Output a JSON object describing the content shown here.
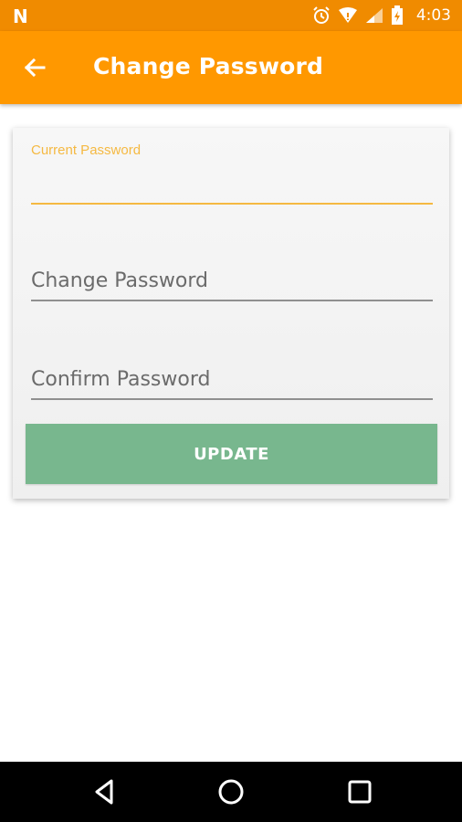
{
  "status_bar": {
    "time": "4:03",
    "notification_icon": "n-logo-icon",
    "icons": [
      "alarm-icon",
      "wifi-icon",
      "cell-signal-icon",
      "battery-icon"
    ],
    "background": "#f08b00"
  },
  "app_bar": {
    "title": "Change Password",
    "back_icon": "back-arrow-icon",
    "background": "#ff9800"
  },
  "form": {
    "current_password": {
      "label": "Current Password",
      "value": ""
    },
    "new_password": {
      "placeholder": "Change Password",
      "value": ""
    },
    "confirm_password": {
      "placeholder": "Confirm Password",
      "value": ""
    },
    "update_label": "UPDATE",
    "accent": "#f5b942",
    "button_color": "#78b78e"
  },
  "nav_bar": {
    "buttons": [
      "back-triangle-icon",
      "home-circle-icon",
      "recents-square-icon"
    ]
  }
}
